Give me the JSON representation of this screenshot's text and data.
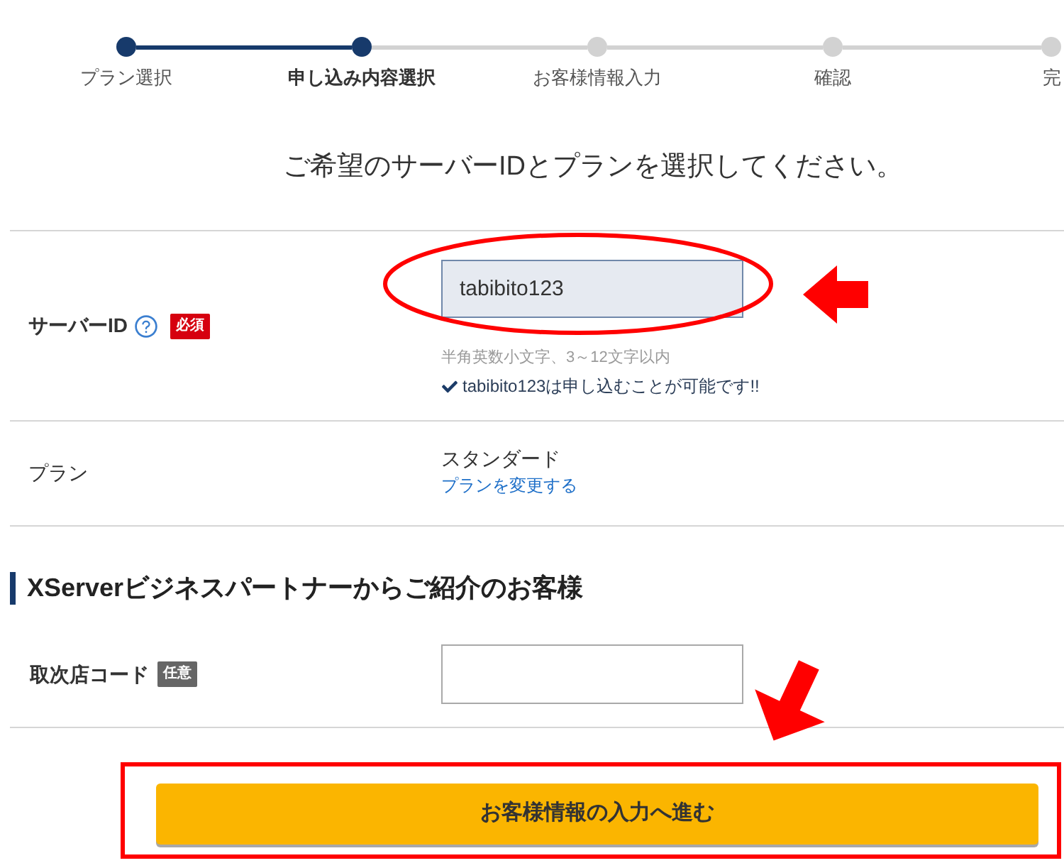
{
  "steps": [
    {
      "label": "プラン選択",
      "completed": true,
      "selected": false
    },
    {
      "label": "申し込み内容選択",
      "completed": true,
      "selected": true
    },
    {
      "label": "お客様情報入力",
      "completed": false,
      "selected": false
    },
    {
      "label": "確認",
      "completed": false,
      "selected": false
    },
    {
      "label": "完",
      "completed": false,
      "selected": false
    }
  ],
  "heading": "ご希望のサーバーIDとプランを選択してください。",
  "form_rows": [
    {
      "kind": "server_id",
      "label": "サーバーID",
      "help_icon": true,
      "badge": {
        "kind": "required",
        "text": "必須"
      },
      "input": {
        "value": "tabibito123"
      },
      "hint": "半角英数小文字、3～12文字以内",
      "status": {
        "ok": true,
        "text": "tabibito123は申し込むことが可能です!!"
      }
    },
    {
      "kind": "plan",
      "label": "プラン",
      "value": "スタンダード",
      "link": "プランを変更する"
    }
  ],
  "partner_section": {
    "title": "XServerビジネスパートナーからご紹介のお客様",
    "rows": [
      {
        "kind": "code",
        "label": "取次店コード",
        "badge": {
          "kind": "optional",
          "text": "任意"
        }
      }
    ]
  },
  "submit_button": "お客様情報の入力へ進む"
}
